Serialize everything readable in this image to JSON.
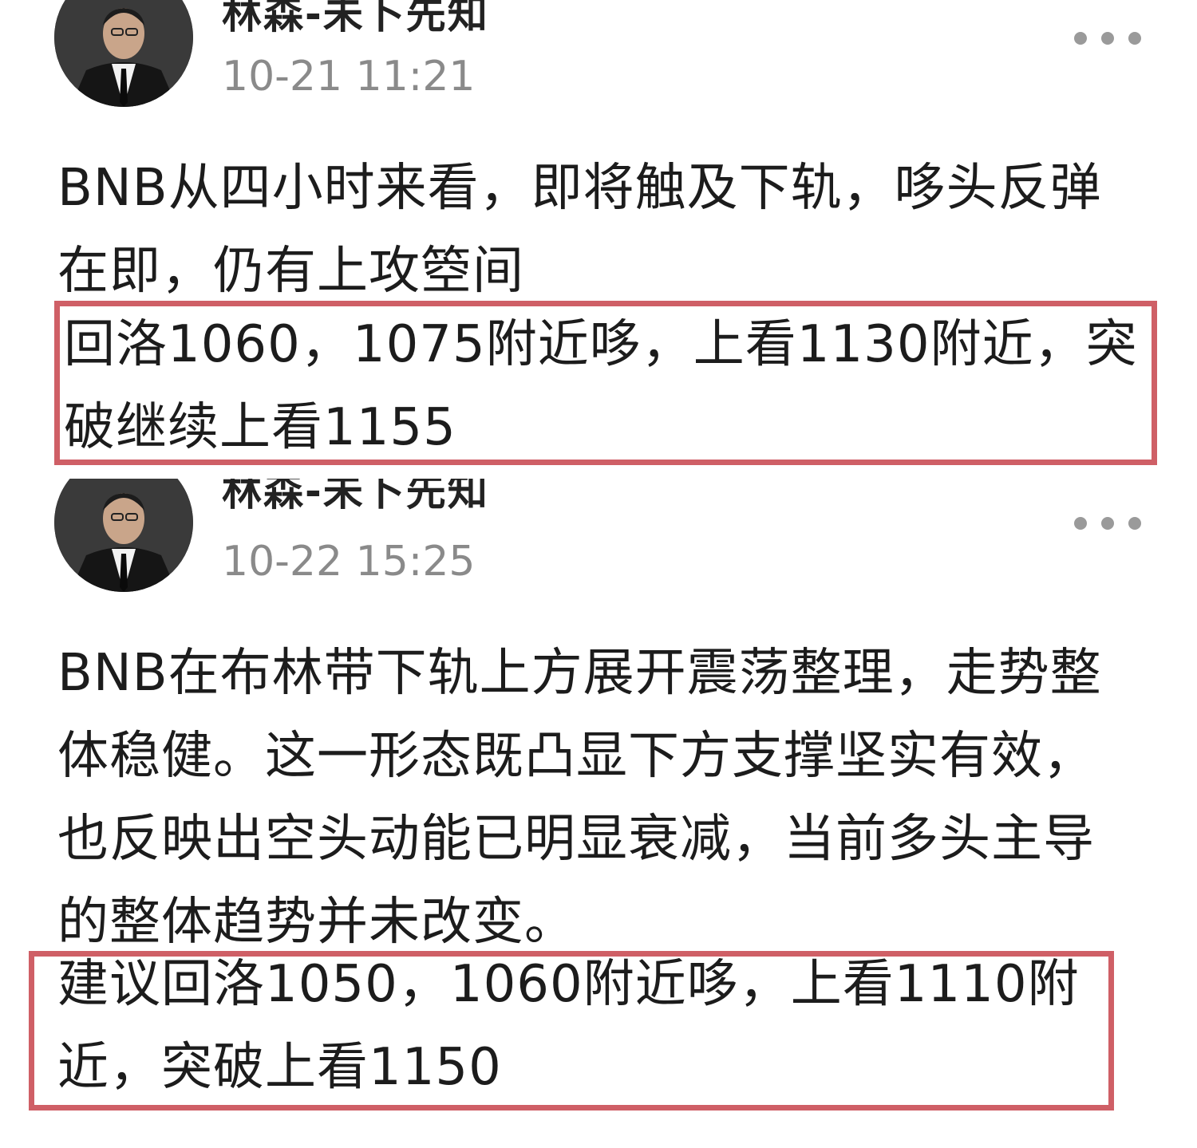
{
  "posts": [
    {
      "author": "林森-未卜先知",
      "time": "10-21 11:21",
      "avatar_icon": "avatar-man-in-suit",
      "more_icon": "more-dots-icon",
      "body_line": "BNB从四小时来看，即将触及下轨，哆头反弹在即，仍有上攻箜间",
      "highlight_text": "回洛1060，1075附近哆，上看1130附近，突破继续上看1155"
    },
    {
      "author": "林森-未卜先知",
      "time": "10-22 15:25",
      "avatar_icon": "avatar-man-in-suit",
      "more_icon": "more-dots-icon",
      "body_line": "BNB在布林带下轨上方展开震荡整理，走势整体稳健。这一形态既凸显下方支撑坚实有效，也反映出空头动能已明显衰减，当前多头主导的整体趋势并未改变。",
      "highlight_text": "建议回洛1050，1060附近哆，上看1110附近，突破上看1150"
    }
  ],
  "highlight_color": "#cf5f66",
  "time_color": "#8a8a8a"
}
